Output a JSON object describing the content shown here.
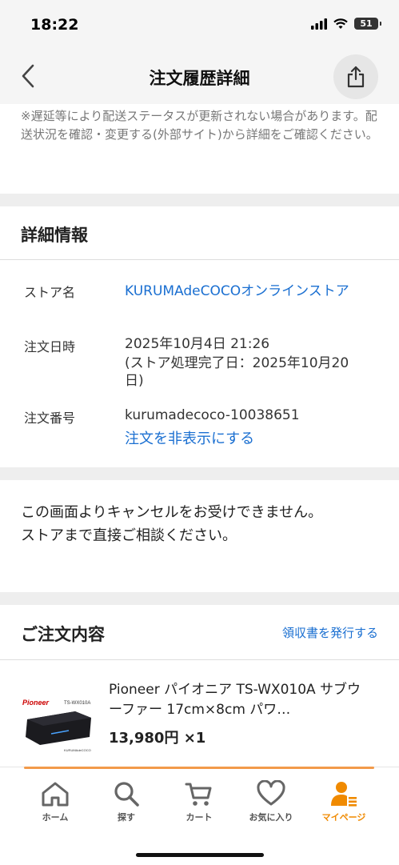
{
  "status": {
    "time": "18:22",
    "battery": "51"
  },
  "nav": {
    "title": "注文履歴詳細",
    "back_icon": "chevron-left-icon",
    "share_icon": "share-icon"
  },
  "notice": {
    "text": "※遅延等により配送ステータスが更新されない場合があります。配送状況を確認・変更する(外部サイト)から詳細をご確認ください。"
  },
  "details": {
    "title": "詳細情報",
    "store_label": "ストア名",
    "store_name": "KURUMAdeCOCOオンラインストア",
    "date_label": "注文日時",
    "date_value": "2025年10月4日 21:26",
    "completion": "(ストア処理完了日：2025年10月20日)",
    "number_label": "注文番号",
    "number_value": "kurumadecoco-10038651",
    "hide_link": "注文を非表示にする"
  },
  "cancel_notice": {
    "line1": "この画面よりキャンセルをお受けできません。",
    "line2": "ストアまで直接ご相談ください。"
  },
  "order": {
    "title": "ご注文内容",
    "receipt_link": "領収書を発行する",
    "item": {
      "name": "Pioneer パイオニア TS-WX010A サブウーファー 17cm×8cm パワ…",
      "price": "13,980円 ×1",
      "thumb_brand": "Pioneer",
      "thumb_model": "TS-WX010A",
      "thumb_store": "KURUMAdeCOCO"
    }
  },
  "tabs": [
    {
      "label": "ホーム",
      "icon": "home-icon"
    },
    {
      "label": "探す",
      "icon": "search-icon"
    },
    {
      "label": "カート",
      "icon": "cart-icon"
    },
    {
      "label": "お気に入り",
      "icon": "heart-icon"
    },
    {
      "label": "マイページ",
      "icon": "user-icon"
    }
  ],
  "colors": {
    "accent": "#f08a00",
    "link": "#1a6fd1"
  }
}
